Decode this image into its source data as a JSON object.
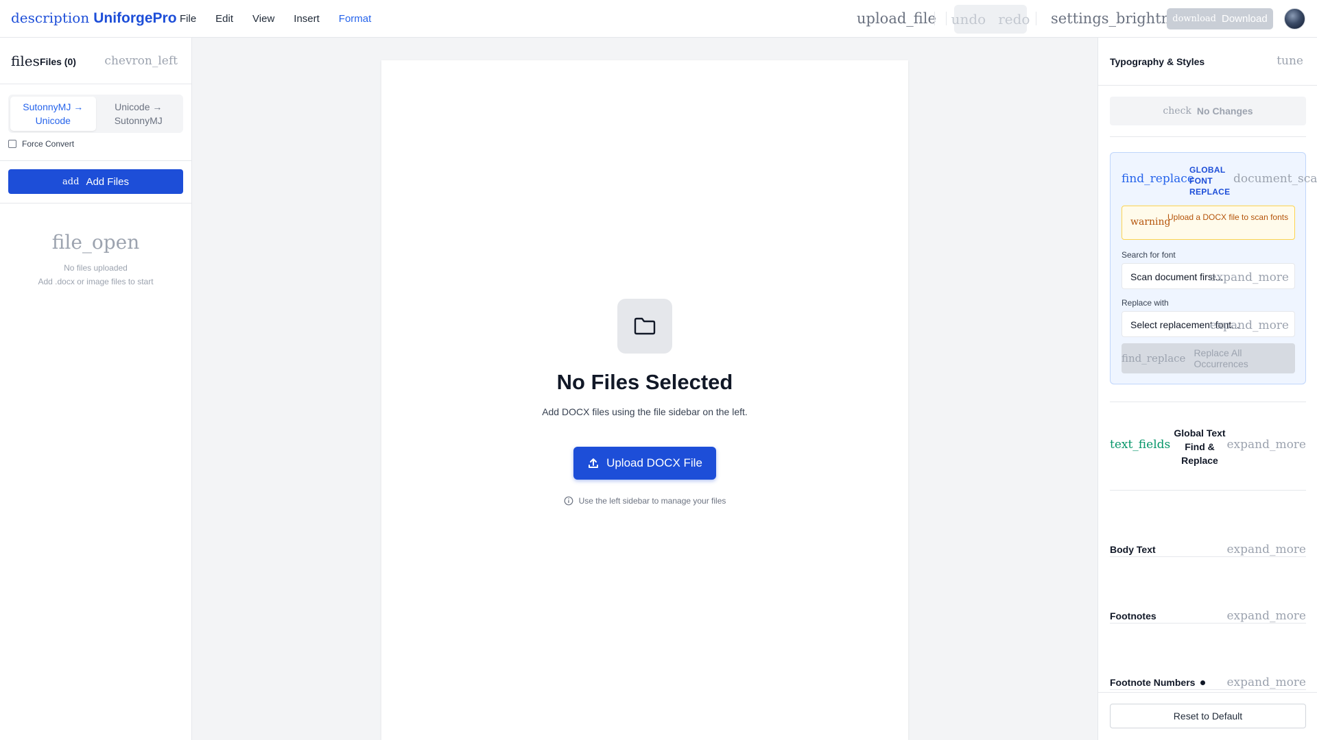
{
  "header": {
    "logo_icon": "description",
    "logo_text": "UniforgePro",
    "menu": [
      "File",
      "Edit",
      "View",
      "Insert",
      "Format"
    ],
    "upload_icon": "upload_file",
    "undo_icon": "undo",
    "redo_icon": "redo",
    "brightness_icon": "settings_brightness",
    "download_icon": "download",
    "download_label": "Download"
  },
  "left_sidebar": {
    "files_icon": "files",
    "files_title": "Files (0)",
    "collapse_icon": "chevron_left",
    "modes": [
      "SutonnyMJ → Unicode",
      "Unicode → SutonnyMJ"
    ],
    "force_convert_label": "Force Convert",
    "add_icon": "add",
    "add_files_label": "Add Files",
    "empty_icon": "file_open",
    "empty_line1": "No files uploaded",
    "empty_line2": "Add .docx or image files to start"
  },
  "center": {
    "title": "No Files Selected",
    "subtitle": "Add DOCX files using the file sidebar on the left.",
    "upload_button": "Upload DOCX File",
    "hint": "Use the left sidebar to manage your files"
  },
  "right_sidebar": {
    "title": "Typography & Styles",
    "tune_icon": "tune",
    "check_icon": "check",
    "no_changes": "No Changes",
    "gfr": {
      "icon": "find_replace",
      "title": "GLOBAL FONT REPLACE",
      "scan_icon": "document_scanner",
      "warning_icon": "warning",
      "warning_text": "Upload a DOCX file to scan fonts",
      "search_label": "Search for font",
      "search_value": "Scan document first...",
      "replace_label": "Replace with",
      "replace_value": "Select replacement font...",
      "expand_icon": "expand_more",
      "replace_all_icon": "find_replace",
      "replace_all_label": "Replace All Occurrences"
    },
    "gtfr": {
      "icon": "text_fields",
      "title": "Global Text Find & Replace",
      "expand_icon": "expand_more"
    },
    "sections": [
      {
        "title": "Body Text",
        "expand_icon": "expand_more"
      },
      {
        "title": "Footnotes",
        "expand_icon": "expand_more"
      },
      {
        "title": "Footnote Numbers",
        "expand_icon": "expand_more"
      }
    ],
    "reset_label": "Reset to Default"
  }
}
